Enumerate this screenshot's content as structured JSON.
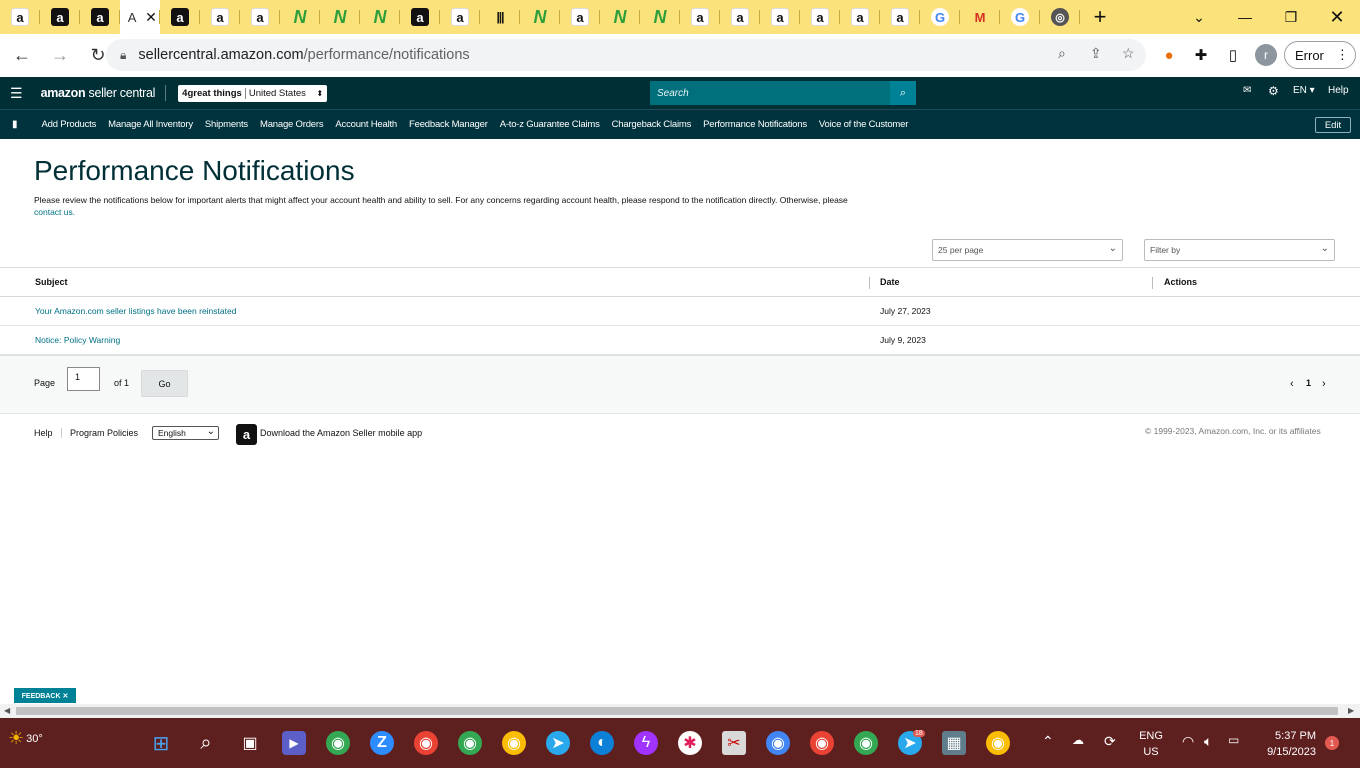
{
  "browser": {
    "tabs": [
      {
        "favicon": "amazon",
        "label": "a"
      },
      {
        "favicon": "amazon-dark",
        "label": "a"
      },
      {
        "favicon": "amazon-dark",
        "label": "a"
      },
      {
        "favicon": "active",
        "label": "A"
      },
      {
        "favicon": "amazon-dark",
        "label": "a"
      },
      {
        "favicon": "amazon",
        "label": "a"
      },
      {
        "favicon": "amazon",
        "label": "a"
      },
      {
        "favicon": "nova",
        "label": "N"
      },
      {
        "favicon": "nova",
        "label": "N"
      },
      {
        "favicon": "nova",
        "label": "N"
      },
      {
        "favicon": "amazon-dark",
        "label": "a"
      },
      {
        "favicon": "amazon",
        "label": "a"
      },
      {
        "favicon": "barcode",
        "label": "|||"
      },
      {
        "favicon": "nova",
        "label": "N"
      },
      {
        "favicon": "amazon",
        "label": "a"
      },
      {
        "favicon": "nova",
        "label": "N"
      },
      {
        "favicon": "nova",
        "label": "N"
      },
      {
        "favicon": "amazon",
        "label": "a"
      },
      {
        "favicon": "amazon",
        "label": "a"
      },
      {
        "favicon": "amazon",
        "label": "a"
      },
      {
        "favicon": "amazon",
        "label": "a"
      },
      {
        "favicon": "amazon",
        "label": "a"
      },
      {
        "favicon": "amazon",
        "label": "a"
      },
      {
        "favicon": "google",
        "label": "G"
      },
      {
        "favicon": "gmail",
        "label": "M"
      },
      {
        "favicon": "google",
        "label": "G"
      },
      {
        "favicon": "chrome",
        "label": "◎"
      }
    ],
    "url_host": "sellercentral.amazon.com",
    "url_path": "/performance/notifications",
    "profile_initial": "r",
    "error_label": "Error"
  },
  "seller_central": {
    "logo_brand": "amazon",
    "logo_suffix": "seller central",
    "account_name": "4great things",
    "marketplace": "United States",
    "search_placeholder": "Search",
    "language": "EN",
    "help": "Help",
    "nav": [
      "Add Products",
      "Manage All Inventory",
      "Shipments",
      "Manage Orders",
      "Account Health",
      "Feedback Manager",
      "A-to-z Guarantee Claims",
      "Chargeback Claims",
      "Performance Notifications",
      "Voice of the Customer"
    ],
    "edit": "Edit"
  },
  "page": {
    "title": "Performance Notifications",
    "description": "Please review the notifications below for important alerts that might affect your account health and ability to sell. For any concerns regarding account health, please respond to the notification directly. Otherwise, please",
    "contact_link": "contact us.",
    "per_page": "25 per page",
    "filter_placeholder": "Filter by",
    "columns": {
      "subject": "Subject",
      "date": "Date",
      "actions": "Actions"
    },
    "rows": [
      {
        "subject": "Your Amazon.com seller listings have been reinstated",
        "date": "July 27, 2023"
      },
      {
        "subject": "Notice: Policy Warning",
        "date": "July 9, 2023"
      }
    ],
    "pager": {
      "page_label": "Page",
      "page_value": "1",
      "of_label": "of 1",
      "go": "Go",
      "current": "1"
    }
  },
  "footer": {
    "help": "Help",
    "policies": "Program Policies",
    "language": "English",
    "app_text": "Download the Amazon Seller mobile app",
    "copyright": "© 1999-2023, Amazon.com, Inc. or its affiliates"
  },
  "feedback": "FEEDBACK ✕",
  "taskbar": {
    "temperature": "30°",
    "lang_line1": "ENG",
    "lang_line2": "US",
    "time": "5:37 PM",
    "date": "9/15/2023",
    "notification_count": "1",
    "telegram_badge": "18"
  }
}
